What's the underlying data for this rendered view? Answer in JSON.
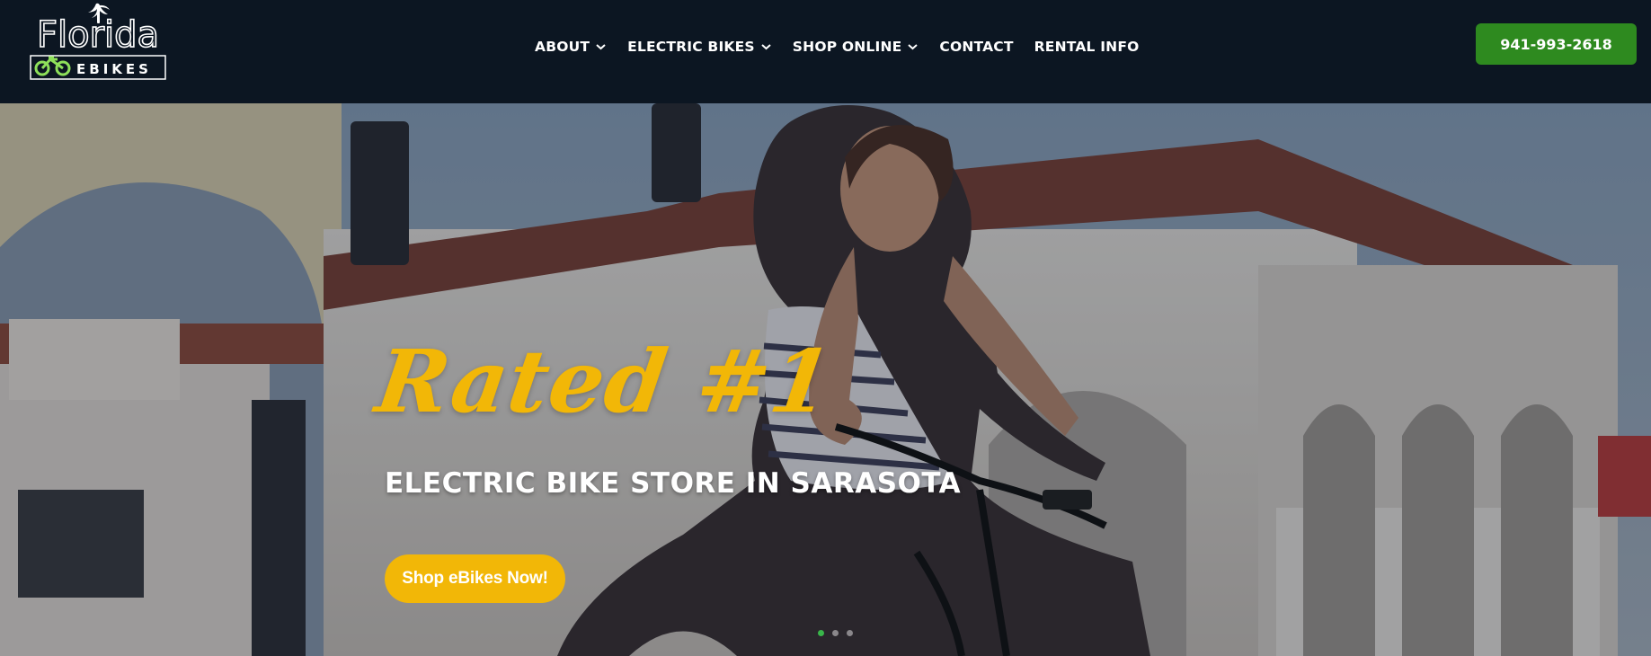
{
  "logo": {
    "word": "Florida",
    "sub": "EBIKES"
  },
  "nav": {
    "items": [
      {
        "label": "ABOUT",
        "has_dropdown": true
      },
      {
        "label": "ELECTRIC BIKES",
        "has_dropdown": true
      },
      {
        "label": "SHOP ONLINE",
        "has_dropdown": true
      },
      {
        "label": "CONTACT",
        "has_dropdown": false
      },
      {
        "label": "RENTAL INFO",
        "has_dropdown": false
      }
    ]
  },
  "phone_button": {
    "label": "941-993-2618"
  },
  "hero": {
    "headline": "Rated #1",
    "subheadline": "ELECTRIC BIKE STORE IN SARASOTA",
    "cta_label": "Shop eBikes Now!",
    "slides_count": 3,
    "active_slide": 1
  },
  "colors": {
    "header_bg": "#0c1622",
    "accent_yellow": "#f2b707",
    "phone_green": "#2e8a1f",
    "logo_green": "#8ee05a",
    "dot_active": "#39b54a"
  },
  "icons": {
    "dropdown": "chevron-down-icon",
    "logo_leaf": "palm-tree-icon",
    "logo_bike": "bicycle-icon"
  }
}
